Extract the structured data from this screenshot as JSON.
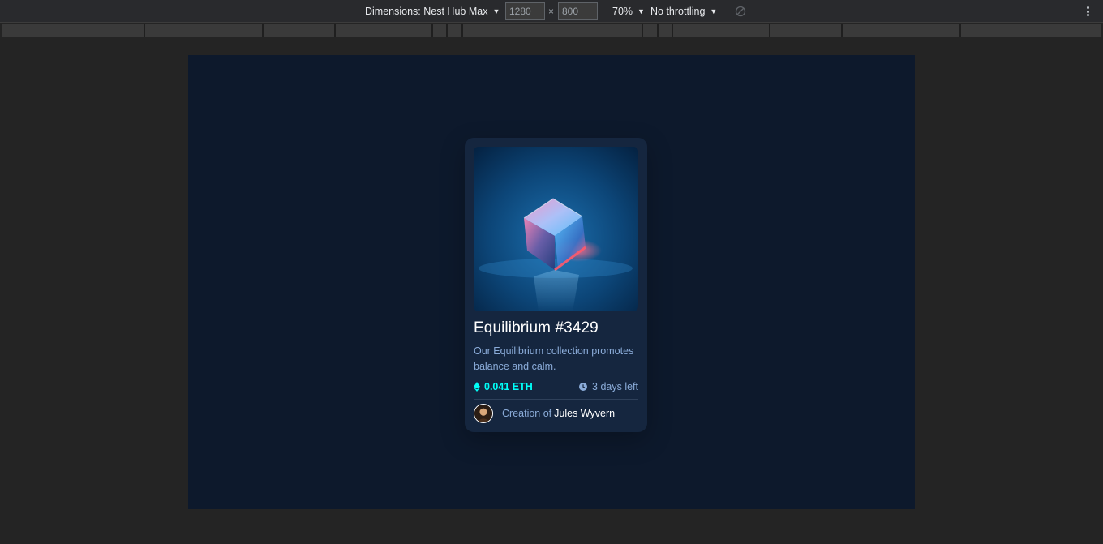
{
  "devtools": {
    "device_label": "Dimensions: Nest Hub Max",
    "width_value": "1280",
    "height_value": "800",
    "times_symbol": "×",
    "zoom": "70%",
    "throttling": "No throttling",
    "icons": {
      "device_dropdown": "caret-down-icon",
      "rotate": "rotate-disabled-icon",
      "more": "more-vert-icon"
    }
  },
  "card": {
    "title": "Equilibrium #3429",
    "description": "Our Equilibrium collection promotes balance and calm.",
    "price": "0.041 ETH",
    "time_left": "3 days left",
    "creator_prefix": "Creation of",
    "creator_name": "Jules Wyvern",
    "icons": {
      "price": "ethereum-icon",
      "time": "clock-icon"
    }
  },
  "colors": {
    "page_bg": "#0d192c",
    "card_bg": "#15263f",
    "accent_cyan": "#00fff8",
    "soft_blue": "#8bacd9",
    "white": "#ffffff",
    "devtools_bg": "#242424"
  }
}
